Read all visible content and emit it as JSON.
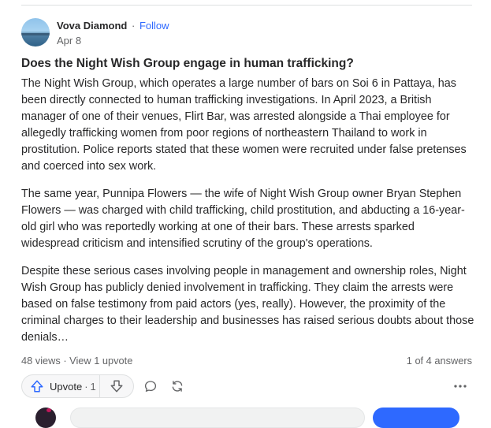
{
  "author": {
    "name": "Vova Diamond",
    "separator": "·",
    "follow_label": "Follow",
    "date": "Apr 8"
  },
  "question": {
    "title": "Does the Night Wish Group engage in human trafficking?"
  },
  "answer": {
    "paragraphs": [
      "The Night Wish Group, which operates a large number of bars on Soi 6 in Pattaya, has been directly connected to human trafficking investigations. In April 2023, a British manager of one of their venues, Flirt Bar, was arrested alongside a Thai employee for allegedly trafficking women from poor regions of northeastern Thailand to work in prostitution. Police reports stated that these women were recruited under false pretenses and coerced into sex work.",
      "The same year, Punnipa Flowers — the wife of Night Wish Group owner Bryan Stephen Flowers — was charged with child trafficking, child prostitution, and abducting a 16-year-old girl who was reportedly working at one of their bars. These arrests sparked widespread criticism and intensified scrutiny of the group's operations.",
      "Despite these serious cases involving people in management and ownership roles, Night Wish Group has publicly denied involvement in trafficking. They claim the arrests were based on false testimony from paid actors (yes, really). However, the proximity of the criminal charges to their leadership and businesses has raised serious doubts about those denials…"
    ]
  },
  "stats": {
    "views_upvotes": "48 views · View 1 upvote",
    "answer_position": "1 of 4 answers"
  },
  "actions": {
    "upvote_label": "Upvote",
    "upvote_separator": "·",
    "upvote_count": "1",
    "icons": {
      "upvote": "upvote-arrow-icon",
      "downvote": "downvote-arrow-icon",
      "comment": "comment-bubble-icon",
      "share": "reshare-icon",
      "more": "more-dots-icon"
    }
  },
  "colors": {
    "accent": "#2e69ff",
    "text": "#282829",
    "muted": "#636466",
    "border": "#dee0e1"
  }
}
